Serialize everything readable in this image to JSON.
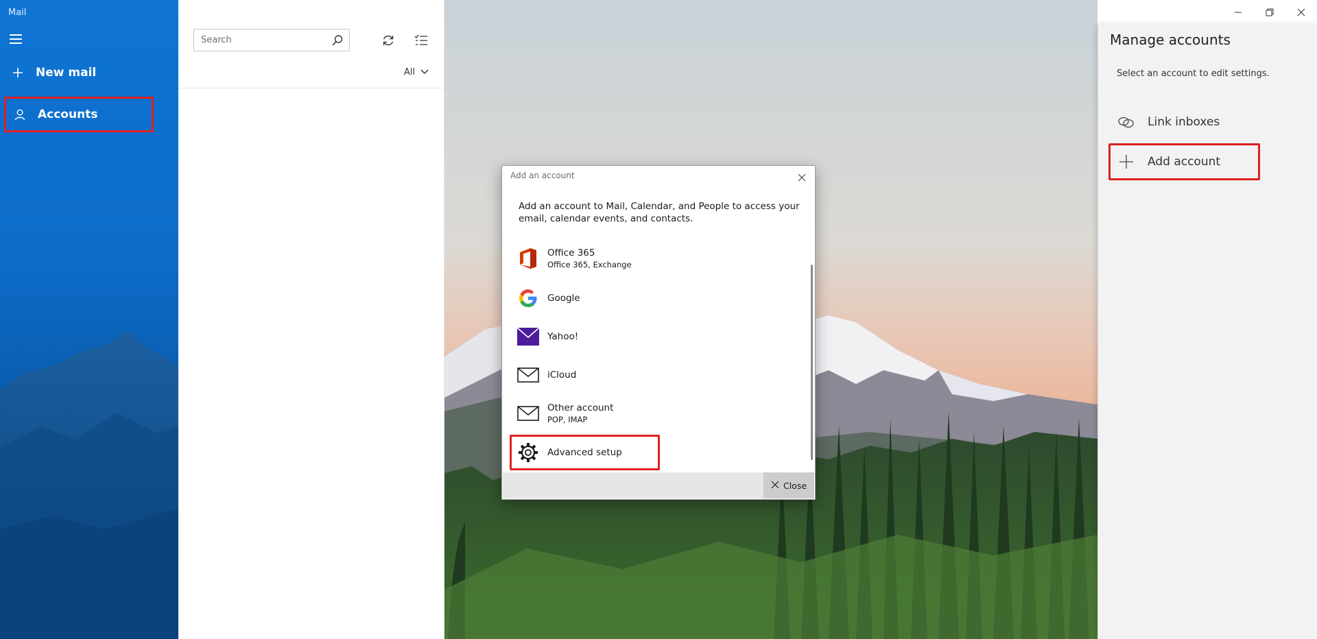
{
  "app": {
    "title": "Mail"
  },
  "nav": {
    "new_mail": "New mail",
    "accounts": "Accounts"
  },
  "list": {
    "search_placeholder": "Search",
    "filter_label": "All"
  },
  "flyout": {
    "title": "Manage accounts",
    "description": "Select an account to edit settings.",
    "link_inboxes": "Link inboxes",
    "add_account": "Add account"
  },
  "dialog": {
    "title": "Add an account",
    "intro": "Add an account to Mail, Calendar, and People to access your email, calendar events, and contacts.",
    "accounts": [
      {
        "name": "Office 365",
        "sub": "Office 365, Exchange",
        "icon": "office365-icon"
      },
      {
        "name": "Google",
        "sub": "",
        "icon": "google-icon"
      },
      {
        "name": "Yahoo!",
        "sub": "",
        "icon": "yahoo-icon"
      },
      {
        "name": "iCloud",
        "sub": "",
        "icon": "mail-envelope-icon"
      },
      {
        "name": "Other account",
        "sub": "POP, IMAP",
        "icon": "mail-envelope-icon"
      },
      {
        "name": "Advanced setup",
        "sub": "",
        "icon": "gear-icon"
      }
    ],
    "close_label": "Close"
  },
  "colors": {
    "nav_blue": "#0f74d4",
    "highlight_red": "#e02020",
    "yahoo_purple": "#4b1c9c",
    "office_red": "#d83b01"
  }
}
